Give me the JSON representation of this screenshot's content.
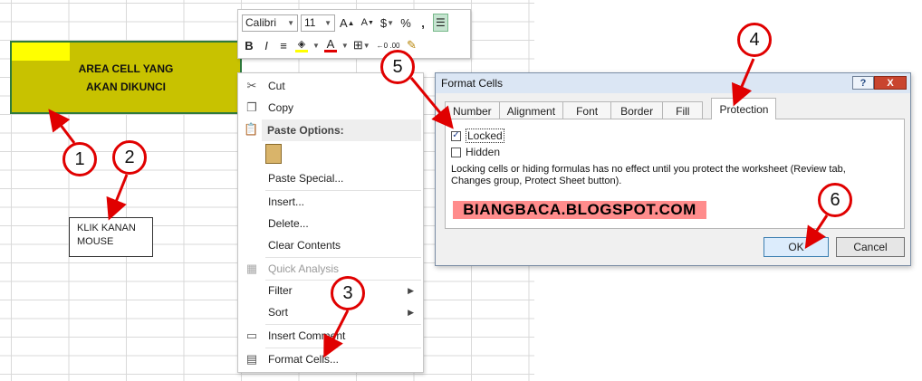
{
  "sheet": {
    "area_cell_line1": "AREA CELL YANG",
    "area_cell_line2": "AKAN DIKUNCI",
    "note_line1": "KLIK KANAN",
    "note_line2": "MOUSE"
  },
  "annotations": {
    "c1": "1",
    "c2": "2",
    "c3": "3",
    "c4": "4",
    "c5": "5",
    "c6": "6",
    "color": "#e00000"
  },
  "mini_toolbar": {
    "font_name": "Calibri",
    "font_size": "11",
    "grow_font": "A",
    "shrink_font": "A",
    "currency": "$",
    "percent": "%",
    "comma": ",",
    "bold": "B",
    "italic": "I",
    "font_color": "A",
    "decimals": "←0 .00"
  },
  "context_menu": {
    "cut": "Cut",
    "copy": "Copy",
    "paste_options": "Paste Options:",
    "paste_special": "Paste Special...",
    "insert": "Insert...",
    "delete": "Delete...",
    "clear_contents": "Clear Contents",
    "quick_analysis": "Quick Analysis",
    "filter": "Filter",
    "sort": "Sort",
    "insert_comment": "Insert Comment",
    "format_cells": "Format Cells..."
  },
  "dialog": {
    "title": "Format Cells",
    "help": "?",
    "close": "X",
    "tabs": [
      "Number",
      "Alignment",
      "Font",
      "Border",
      "Fill",
      "Protection"
    ],
    "locked": "Locked",
    "hidden": "Hidden",
    "locked_checked": true,
    "hidden_checked": false,
    "description_line1": "Locking cells or hiding formulas has no effect until you protect the worksheet (Review tab,",
    "description_line2": "Changes group, Protect Sheet button).",
    "watermark": "BIANGBACA.BLOGSPOT.COM",
    "ok": "OK",
    "cancel": "Cancel"
  }
}
